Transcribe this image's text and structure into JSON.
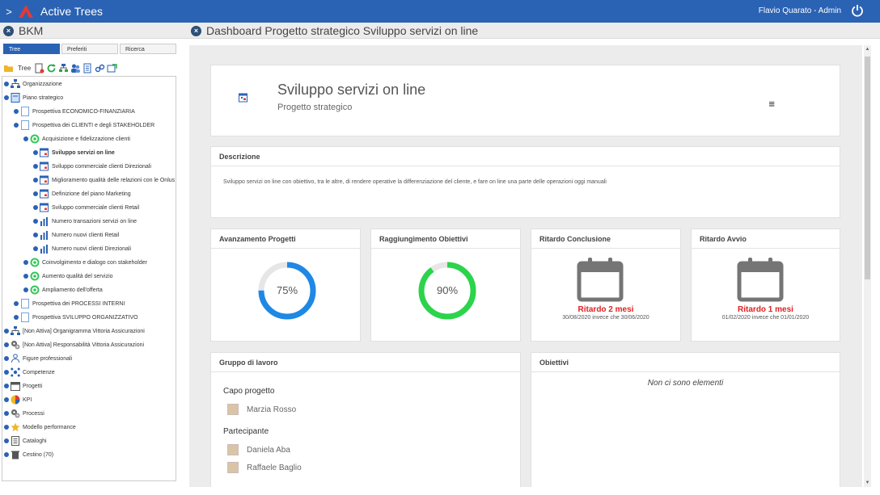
{
  "app": {
    "title": "Active Trees",
    "user": "Flavio Quarato - Admin"
  },
  "left_header": {
    "title": "BKM"
  },
  "main_header": {
    "title": "Dashboard Progetto strategico Sviluppo servizi on line"
  },
  "tabs": [
    {
      "label": "Tree",
      "active": true
    },
    {
      "label": "Preferiti",
      "active": false
    },
    {
      "label": "Ricerca",
      "active": false
    }
  ],
  "toolbar": {
    "label": "Tree"
  },
  "tree": [
    {
      "label": "Organizzazione",
      "level": 0,
      "icon": "org-icon"
    },
    {
      "label": "Piano strategico",
      "level": 0,
      "icon": "plan-icon"
    },
    {
      "label": "Prospettiva ECONOMICO-FINANZIARIA",
      "level": 1,
      "icon": "page-icon"
    },
    {
      "label": "Prospettiva dei CLIENTI e degli STAKEHOLDER",
      "level": 1,
      "icon": "page-icon"
    },
    {
      "label": "Acquisizione e fidelizzazione clienti",
      "level": 2,
      "icon": "target-icon"
    },
    {
      "label": "Sviluppo servizi on line",
      "level": 3,
      "icon": "project-icon",
      "bold": true
    },
    {
      "label": "Sviluppo commerciale clienti Direzionali",
      "level": 3,
      "icon": "project-icon"
    },
    {
      "label": "Miglioramento qualità delle relazioni con le Onlus",
      "level": 3,
      "icon": "project-icon"
    },
    {
      "label": "Definizione del piano Marketing",
      "level": 3,
      "icon": "project-icon"
    },
    {
      "label": "Sviluppo commerciale clienti Retail",
      "level": 3,
      "icon": "project-icon"
    },
    {
      "label": "Numero transazioni servizi on line",
      "level": 3,
      "icon": "bar-chart-icon"
    },
    {
      "label": "Numero nuovi clienti Retail",
      "level": 3,
      "icon": "bar-chart-icon"
    },
    {
      "label": "Numero nuovi clienti Direzionali",
      "level": 3,
      "icon": "bar-chart-icon"
    },
    {
      "label": "Coinvolgimento e dialogo con stakeholder",
      "level": 2,
      "icon": "target-icon"
    },
    {
      "label": "Aumento qualità del servizio",
      "level": 2,
      "icon": "target-icon"
    },
    {
      "label": "Ampliamento dell'offerta",
      "level": 2,
      "icon": "target-icon"
    },
    {
      "label": "Prospettiva dei PROCESSI INTERNI",
      "level": 1,
      "icon": "page-icon"
    },
    {
      "label": "Prospettiva SVILUPPO ORGANIZZATIVO",
      "level": 1,
      "icon": "page-icon"
    },
    {
      "label": "[Non Attiva] Organigramma Vittoria Assicurazioni",
      "level": 0,
      "icon": "org-icon"
    },
    {
      "label": "[Non Attiva] Responsabilità Vittoria Assicurazioni",
      "level": 0,
      "icon": "gears-icon"
    },
    {
      "label": "Figure professionali",
      "level": 0,
      "icon": "people-icon"
    },
    {
      "label": "Competenze",
      "level": 0,
      "icon": "network-icon"
    },
    {
      "label": "Progetti",
      "level": 0,
      "icon": "calendar-icon"
    },
    {
      "label": "KPI",
      "level": 0,
      "icon": "pie-icon"
    },
    {
      "label": "Processi",
      "level": 0,
      "icon": "gears-icon"
    },
    {
      "label": "Modello performance",
      "level": 0,
      "icon": "star-icon"
    },
    {
      "label": "Cataloghi",
      "level": 0,
      "icon": "catalog-icon"
    },
    {
      "label": "Cestino (70)",
      "level": 0,
      "icon": "trash-icon"
    }
  ],
  "hero": {
    "title": "Sviluppo servizi on line",
    "subtitle": "Progetto strategico",
    "menu_glyph": "≡"
  },
  "description": {
    "title": "Descrizione",
    "text": "Sviluppo servizi on line con obiettivo, tra le altre, di rendere operative la differenziazione del cliente, e fare on line una parte delle operazioni oggi manuali"
  },
  "kpis": [
    {
      "title": "Avanzamento Progetti",
      "value": 0.75,
      "label": "75%",
      "color": "#1e88e5"
    },
    {
      "title": "Raggiungimento Obiettivi",
      "value": 0.9,
      "label": "90%",
      "color": "#2bd44b"
    }
  ],
  "delays": [
    {
      "title": "Ritardo Conclusione",
      "status": "Ritardo 2 mesi",
      "detail": "30/08/2020 invece che 30/06/2020"
    },
    {
      "title": "Ritardo Avvio",
      "status": "Ritardo 1 mesi",
      "detail": "01/02/2020 invece che 01/01/2020"
    }
  ],
  "team": {
    "title": "Gruppo di lavoro",
    "lead_label": "Capo progetto",
    "lead": "Marzia Rosso",
    "members_label": "Partecipante",
    "members": [
      "Daniela Aba",
      "Raffaele Baglio"
    ]
  },
  "objectives": {
    "title": "Obiettivi",
    "empty": "Non ci sono elementi"
  },
  "colors": {
    "header": "#2a62b4",
    "accent_red": "#e02020"
  }
}
